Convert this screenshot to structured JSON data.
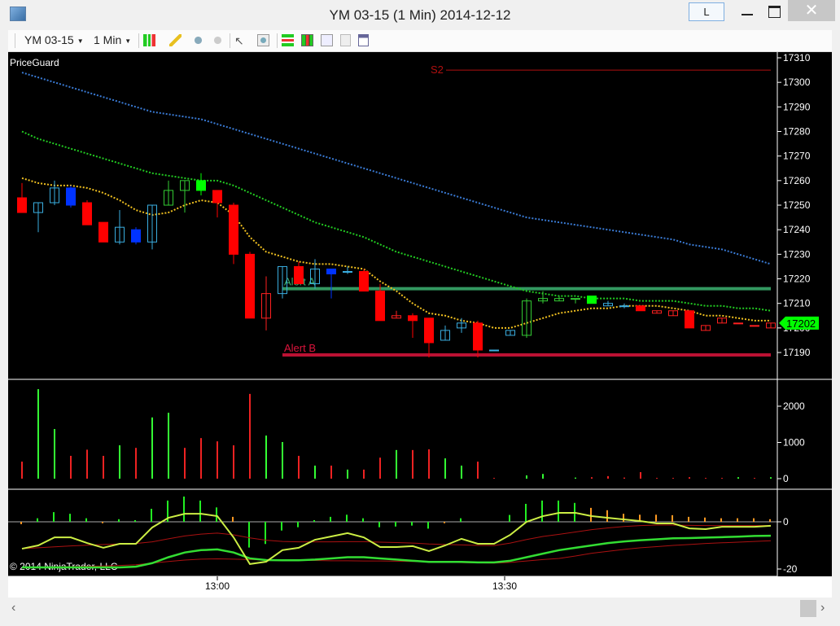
{
  "window": {
    "title": "YM 03-15 (1 Min)  2014-12-12",
    "link_button": "L",
    "close_glyph": "✕"
  },
  "toolbar": {
    "instrument": "YM 03-15",
    "interval": "1 Min",
    "icons": [
      "chart-style-icon",
      "drawing-tool-icon",
      "add-indicator-icon",
      "remove-indicator-icon",
      "cursor-icon",
      "zoom-icon",
      "strategies-icon",
      "bar-type-icon",
      "indicators-icon",
      "data-box-icon",
      "properties-icon"
    ]
  },
  "chart": {
    "indicator_label": "PriceGuard",
    "copyright": "© 2014 NinjaTrader, LLC",
    "scroll_left": "‹",
    "scroll_right": "›"
  },
  "chart_data": [
    {
      "type": "candlestick",
      "panel": "price",
      "ylim": [
        17185,
        17312
      ],
      "y_ticks": [
        "17190",
        "17200",
        "17210",
        "17220",
        "17230",
        "17240",
        "17250",
        "17260",
        "17270",
        "17280",
        "17290",
        "17300",
        "17310"
      ],
      "last_price": "17202",
      "colors": {
        "red": "#ff0000",
        "red-hollow": "#ff2020",
        "cyan-hollow": "#3aaee0",
        "blue": "#0033ff",
        "green-hollow": "#33cc33",
        "lime": "#00ff00"
      },
      "candles": [
        [
          17253,
          17259,
          17247,
          17247,
          "red"
        ],
        [
          17247,
          17251,
          17239,
          17251,
          "cyan-hollow"
        ],
        [
          17251,
          17260,
          17250,
          17257,
          "cyan-hollow"
        ],
        [
          17257,
          17258,
          17249,
          17250,
          "blue"
        ],
        [
          17251,
          17252,
          17242,
          17242,
          "red"
        ],
        [
          17243,
          17243,
          17235,
          17235,
          "red"
        ],
        [
          17235,
          17248,
          17234,
          17241,
          "cyan-hollow"
        ],
        [
          17240,
          17241,
          17234,
          17235,
          "blue"
        ],
        [
          17235,
          17250,
          17232,
          17250,
          "cyan-hollow"
        ],
        [
          17250,
          17260,
          17250,
          17256,
          "green-hollow"
        ],
        [
          17256,
          17260,
          17247,
          17260,
          "green-hollow"
        ],
        [
          17256,
          17263,
          17254,
          17260,
          "lime"
        ],
        [
          17256,
          17256,
          17245,
          17251,
          "red"
        ],
        [
          17250,
          17251,
          17226,
          17230,
          "red"
        ],
        [
          17230,
          17231,
          17204,
          17204,
          "red"
        ],
        [
          17214,
          17221,
          17199,
          17204,
          "red-hollow"
        ],
        [
          17214,
          17225,
          17212,
          17225,
          "cyan-hollow"
        ],
        [
          17225,
          17227,
          17218,
          17218,
          "red"
        ],
        [
          17218,
          17228,
          17216,
          17224,
          "cyan-hollow"
        ],
        [
          17224,
          17224,
          17212,
          17222,
          "blue"
        ],
        [
          17223,
          17225,
          17222,
          17223,
          "cyan-hollow"
        ],
        [
          17223,
          17224,
          17215,
          17215,
          "red"
        ],
        [
          17215,
          17218,
          17203,
          17203,
          "red"
        ],
        [
          17205,
          17207,
          17204,
          17204,
          "red-hollow"
        ],
        [
          17205,
          17206,
          17196,
          17203,
          "red"
        ],
        [
          17204,
          17204,
          17188,
          17194,
          "red"
        ],
        [
          17195,
          17201,
          17195,
          17199,
          "cyan-hollow"
        ],
        [
          17200,
          17204,
          17198,
          17202,
          "cyan-hollow"
        ],
        [
          17202,
          17203,
          17188,
          17191,
          "red"
        ],
        [
          17191,
          17191,
          17191,
          17191,
          "cyan-hollow"
        ],
        [
          17197,
          17199,
          17197,
          17199,
          "cyan-hollow"
        ],
        [
          17197,
          17212,
          17196,
          17211,
          "green-hollow"
        ],
        [
          17211,
          17215,
          17210,
          17212,
          "green-hollow"
        ],
        [
          17211,
          17213,
          17211,
          17212,
          "green-hollow"
        ],
        [
          17212,
          17212,
          17210,
          17212,
          "green-hollow"
        ],
        [
          17213,
          17213,
          17210,
          17210,
          "lime"
        ],
        [
          17209,
          17211,
          17209,
          17210,
          "cyan-hollow"
        ],
        [
          17209,
          17210,
          17208,
          17209,
          "cyan-hollow"
        ],
        [
          17209,
          17209,
          17207,
          17207,
          "red"
        ],
        [
          17207,
          17207,
          17206,
          17206,
          "red-hollow"
        ],
        [
          17207,
          17207,
          17205,
          17205,
          "red-hollow"
        ],
        [
          17207,
          17207,
          17200,
          17200,
          "red"
        ],
        [
          17201,
          17201,
          17199,
          17199,
          "red-hollow"
        ],
        [
          17204,
          17204,
          17202,
          17202,
          "red-hollow"
        ],
        [
          17202,
          17202,
          17202,
          17202,
          "red-hollow"
        ],
        [
          17201,
          17201,
          17201,
          17201,
          "red-hollow"
        ],
        [
          17202,
          17202,
          17200,
          17200,
          "red-hollow"
        ]
      ],
      "lines": [
        {
          "color": "#3a7bd5",
          "values": [
            17304,
            17302,
            17300,
            17298,
            17296,
            17294,
            17292,
            17290,
            17288,
            17287,
            17286,
            17285,
            17283,
            17281,
            17279,
            17277,
            17275,
            17273,
            17271,
            17269,
            17267,
            17265,
            17263,
            17261,
            17259,
            17257,
            17255,
            17253,
            17251,
            17249,
            17247,
            17245,
            17244,
            17243,
            17242,
            17241,
            17240,
            17239,
            17238,
            17237,
            17236,
            17234,
            17233,
            17232,
            17230,
            17228,
            17226
          ]
        },
        {
          "color": "#22cc22",
          "values": [
            17280,
            17277,
            17275,
            17273,
            17271,
            17269,
            17267,
            17265,
            17263,
            17262,
            17261,
            17260,
            17260,
            17258,
            17255,
            17252,
            17249,
            17246,
            17243,
            17241,
            17239,
            17237,
            17234,
            17231,
            17229,
            17227,
            17225,
            17223,
            17221,
            17219,
            17217,
            17215,
            17214,
            17213,
            17213,
            17212,
            17212,
            17212,
            17211,
            17211,
            17211,
            17210,
            17209,
            17209,
            17208,
            17208,
            17207
          ]
        },
        {
          "color": "#f0c020",
          "values": [
            17261,
            17259,
            17258,
            17258,
            17257,
            17255,
            17252,
            17248,
            17246,
            17247,
            17250,
            17252,
            17251,
            17246,
            17237,
            17231,
            17229,
            17227,
            17226,
            17226,
            17225,
            17224,
            17219,
            17215,
            17210,
            17206,
            17205,
            17203,
            17202,
            17200,
            17200,
            17202,
            17204,
            17206,
            17207,
            17208,
            17208,
            17209,
            17209,
            17209,
            17208,
            17207,
            17205,
            17205,
            17204,
            17203,
            17203
          ]
        }
      ],
      "levels": [
        {
          "label": "S2",
          "price": 17305,
          "color": "#b01010"
        },
        {
          "label": "Alert A",
          "price": 17216,
          "color": "#3cb371"
        },
        {
          "label": "Alert B",
          "price": 17189,
          "color": "#dc143c"
        }
      ]
    },
    {
      "type": "bar",
      "panel": "volume",
      "ylim": [
        0,
        2800
      ],
      "y_ticks": [
        "0",
        "1000",
        "2000"
      ],
      "values": [
        470,
        2470,
        1370,
        630,
        800,
        630,
        920,
        850,
        1690,
        1820,
        850,
        1120,
        1030,
        920,
        2340,
        1190,
        1010,
        630,
        360,
        360,
        250,
        250,
        580,
        790,
        790,
        810,
        560,
        360,
        470,
        20,
        0,
        90,
        130,
        0,
        30,
        40,
        70,
        30,
        180,
        20,
        20,
        40,
        20,
        20,
        40,
        20,
        40
      ],
      "colors": [
        "r",
        "g",
        "g",
        "r",
        "r",
        "r",
        "g",
        "r",
        "g",
        "g",
        "r",
        "r",
        "r",
        "r",
        "r",
        "g",
        "g",
        "r",
        "g",
        "r",
        "g",
        "r",
        "r",
        "g",
        "r",
        "r",
        "g",
        "g",
        "r",
        "r",
        "r",
        "g",
        "g",
        "g",
        "g",
        "r",
        "r",
        "r",
        "r",
        "r",
        "r",
        "r",
        "r",
        "r",
        "g",
        "r",
        "g"
      ]
    },
    {
      "type": "line",
      "panel": "oscillator",
      "ylim": [
        -21,
        11
      ],
      "y_ticks": [
        "0",
        "-20"
      ],
      "histogram": [
        -1,
        1.5,
        4.1,
        3.4,
        1.5,
        -0.6,
        1.1,
        0.7,
        5.5,
        9,
        10.7,
        9,
        6.1,
        2.1,
        -10.9,
        -9.4,
        -3.7,
        -2.3,
        0.7,
        2.1,
        3,
        1.5,
        -2.3,
        -2,
        -1.6,
        -2.9,
        -0.6,
        1.5,
        0,
        0,
        2.9,
        7.6,
        9,
        9,
        8,
        5.9,
        4.9,
        3.4,
        3,
        3,
        2.8,
        2.1,
        1.8,
        1.5,
        1.5,
        1.5,
        1.1
      ],
      "histogram_colors": [
        "o",
        "g",
        "g",
        "g",
        "g",
        "o",
        "g",
        "g",
        "g",
        "g",
        "g",
        "g",
        "g",
        "o",
        "g",
        "g",
        "g",
        "g",
        "g",
        "g",
        "g",
        "g",
        "g",
        "g",
        "g",
        "g",
        "o",
        "g",
        "g",
        "g",
        "g",
        "g",
        "g",
        "g",
        "g",
        "o",
        "o",
        "o",
        "o",
        "o",
        "o",
        "o",
        "o",
        "o",
        "o",
        "o",
        "o"
      ],
      "series": [
        {
          "color": "#aa1111",
          "width": 1,
          "values": [
            -11.4,
            -11,
            -10.6,
            -10.2,
            -9.9,
            -9.6,
            -9.4,
            -9.2,
            -8.5,
            -7.2,
            -6,
            -5.2,
            -4.8,
            -5.5,
            -6.8,
            -7.8,
            -8.3,
            -8.5,
            -8.5,
            -8.5,
            -8.4,
            -8.4,
            -8.6,
            -8.8,
            -9,
            -9.4,
            -9.6,
            -9.8,
            -10,
            -10.1,
            -9,
            -7.5,
            -6.2,
            -5.3,
            -4.3,
            -3.3,
            -2.6,
            -2,
            -1.6,
            -1.4,
            -1.4,
            -1.5,
            -1.6,
            -1.6,
            -1.6,
            -1.6,
            -1.6
          ]
        },
        {
          "color": "#aa1111",
          "width": 1,
          "values": [
            -19.3,
            -19.2,
            -19.1,
            -19,
            -18.9,
            -18.7,
            -18.5,
            -18.2,
            -17.5,
            -16.8,
            -16.2,
            -15.8,
            -15.7,
            -15.8,
            -16,
            -16.2,
            -16.3,
            -16.4,
            -16.4,
            -16.5,
            -16.5,
            -16.6,
            -16.6,
            -16.7,
            -16.8,
            -17,
            -17.1,
            -17.3,
            -17.4,
            -17.5,
            -17.2,
            -16.6,
            -16,
            -15.5,
            -14.5,
            -13.3,
            -12.5,
            -11.7,
            -11,
            -10.5,
            -10,
            -9.6,
            -9.2,
            -8.9,
            -8.6,
            -8.3,
            -8
          ]
        },
        {
          "color": "#33dd33",
          "width": 2.5,
          "values": [
            -19.3,
            -19.3,
            -19.3,
            -19.3,
            -19.3,
            -19.3,
            -19.3,
            -19,
            -17.5,
            -15,
            -13,
            -12,
            -11.7,
            -13,
            -15.5,
            -16.2,
            -16.3,
            -16.3,
            -16,
            -15.5,
            -15,
            -15,
            -15.5,
            -16,
            -16.5,
            -17,
            -17,
            -17,
            -17.2,
            -17.2,
            -16.5,
            -15,
            -13.5,
            -12,
            -11,
            -10,
            -9,
            -8.3,
            -7.8,
            -7.4,
            -7,
            -6.9,
            -6.7,
            -6.5,
            -6.3,
            -6,
            -5.9
          ]
        },
        {
          "color": "#ccee44",
          "width": 2,
          "values": [
            -11.4,
            -10,
            -6.6,
            -6.6,
            -9,
            -11,
            -9.3,
            -9.3,
            -2.4,
            1.7,
            3.4,
            3.4,
            2.4,
            -6.6,
            -17.9,
            -16.9,
            -12,
            -11,
            -7.6,
            -6.2,
            -4.8,
            -6.6,
            -10.7,
            -10.7,
            -10.3,
            -12.4,
            -10,
            -7.2,
            -9.3,
            -9.3,
            -5.5,
            0,
            2.4,
            3.8,
            3.8,
            2.4,
            1.7,
            1,
            0.3,
            -0.7,
            -0.7,
            -2.8,
            -3.1,
            -2.1,
            -2.1,
            -2.1,
            -1.7
          ]
        }
      ]
    },
    {
      "type": "axis",
      "panel": "time",
      "x_ticks": [
        "13:00",
        "13:30"
      ]
    }
  ]
}
